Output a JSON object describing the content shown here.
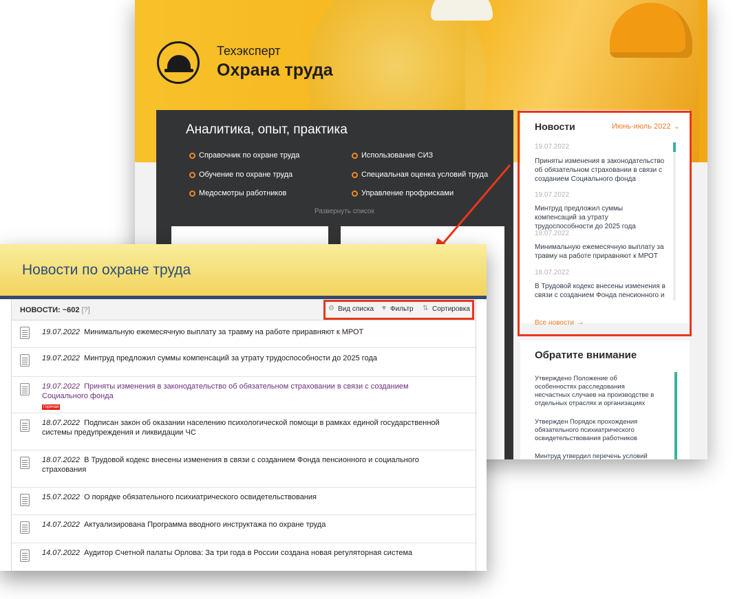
{
  "site": {
    "brand_small": "Техэксперт",
    "brand_main": "Охрана труда"
  },
  "analytics": {
    "title": "Аналитика, опыт, практика",
    "items": [
      "Справочник по охране труда",
      "Использование СИЗ",
      "Обучение по охране труда",
      "Специальная оценка условий труда",
      "Медосмотры работников",
      "Управление профрисками"
    ],
    "expand_label": "Развернуть список"
  },
  "news_column": {
    "title": "Новости",
    "period": "Июнь-июль 2022",
    "items": [
      {
        "date": "19.07.2022",
        "text": "Приняты изменения в законодательство об обязательном страховании в связи с созданием Социального фонда"
      },
      {
        "date": "19.07.2022",
        "text": "Минтруд предложил суммы компенсаций за утрату трудоспособности до 2025 года"
      },
      {
        "date": "19.07.2022",
        "text": "Минимальную ежемесячную выплату за травму на работе приравняют к МРОТ"
      },
      {
        "date": "18.07.2022",
        "text": "В Трудовой кодекс внесены изменения в связи с созданием Фонда пенсионного и"
      }
    ],
    "all_label": "Все новости"
  },
  "attention": {
    "title": "Обратите внимание",
    "items": [
      "Утверждено Положение об особенностях расследования несчастных случаев на производстве в отдельных отраслях и организациях",
      "Утвержден Порядок прохождения обязательного психиатрического освидетельствования работников",
      "Минтруд утвердил перечень условий"
    ]
  },
  "news_page": {
    "title": "Новости по охране труда",
    "count_label": "НОВОСТИ: ~602",
    "help_label": "[?]",
    "tools": {
      "view": "Вид списка",
      "filter": "Фильтр",
      "sort": "Сортировка"
    },
    "hot_label": "Горячая",
    "rows": [
      {
        "date": "19.07.2022",
        "text": "Минимальную ежемесячную выплату за травму на работе приравняют к МРОТ"
      },
      {
        "date": "19.07.2022",
        "text": "Минтруд предложил суммы компенсаций за утрату трудоспособности до 2025 года"
      },
      {
        "date": "19.07.2022",
        "text": "Приняты изменения в законодательство об обязательном страховании в связи с созданием Социального фонда"
      },
      {
        "date": "18.07.2022",
        "text": "Подписан закон об оказании населению психологической помощи в рамках единой государственной системы предупреждения и ликвидации ЧС"
      },
      {
        "date": "18.07.2022",
        "text": "В Трудовой кодекс внесены изменения в связи с созданием Фонда пенсионного и социального страхования"
      },
      {
        "date": "15.07.2022",
        "text": "О порядке обязательного психиатрического освидетельствования"
      },
      {
        "date": "14.07.2022",
        "text": "Актуализирована Программа вводного инструктажа по охране труда"
      },
      {
        "date": "14.07.2022",
        "text": "Аудитор Счетной палаты Орлова: За три года в России создана новая регуляторная система"
      }
    ]
  },
  "colors": {
    "accent_orange": "#ee7a2a",
    "highlight_red": "#e8361b",
    "hero_yellow": "#f6b51c",
    "dark_panel": "#333436",
    "teal": "#3bb1a0",
    "hot_link": "#6b2f7c"
  }
}
